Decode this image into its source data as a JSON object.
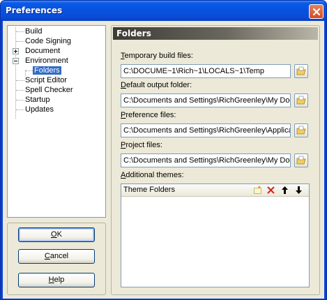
{
  "window": {
    "title": "Preferences"
  },
  "tree": {
    "items": [
      {
        "label": "Build"
      },
      {
        "label": "Code Signing"
      },
      {
        "label": "Document"
      },
      {
        "label": "Environment"
      },
      {
        "label": "Folders"
      },
      {
        "label": "Script Editor"
      },
      {
        "label": "Spell Checker"
      },
      {
        "label": "Startup"
      },
      {
        "label": "Updates"
      }
    ]
  },
  "buttons": {
    "ok": {
      "accel": "O",
      "rest": "K"
    },
    "cancel": {
      "accel": "C",
      "rest": "ancel"
    },
    "help": {
      "accel": "H",
      "rest": "elp"
    }
  },
  "panel": {
    "title": "Folders",
    "fields": [
      {
        "accel": "T",
        "rest": "emporary build files:",
        "value": "C:\\DOCUME~1\\Rich~1\\LOCALS~1\\Temp"
      },
      {
        "accel": "D",
        "rest": "efault output folder:",
        "value": "C:\\Documents and Settings\\RichGreenley\\My Docu"
      },
      {
        "accel": "P",
        "rest": "reference files:",
        "value": "C:\\Documents and Settings\\RichGreenley\\Applicatio"
      },
      {
        "accel": "P",
        "rest": "roject files:",
        "value": "C:\\Documents and Settings\\RichGreenley\\My Docu"
      }
    ],
    "themes": {
      "accel": "A",
      "rest": "dditional themes:",
      "column_header": "Theme Folders",
      "tools": [
        "new-folder-icon",
        "delete-icon",
        "move-up-icon",
        "move-down-icon"
      ]
    }
  },
  "colors": {
    "titlebar": "#0a5ae6",
    "selection": "#316ac5",
    "delete_red": "#d42020"
  }
}
